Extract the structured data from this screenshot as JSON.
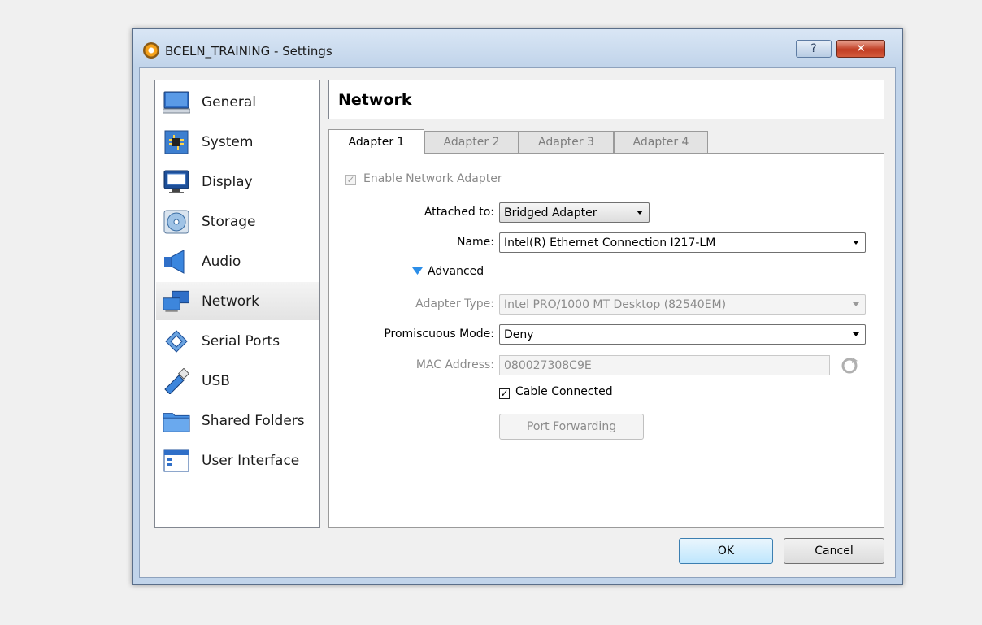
{
  "window": {
    "title": "BCELN_TRAINING - Settings",
    "help_glyph": "?",
    "close_glyph": "✕"
  },
  "sidebar": {
    "items": [
      {
        "label": "General",
        "icon": "monitor-icon"
      },
      {
        "label": "System",
        "icon": "chip-icon"
      },
      {
        "label": "Display",
        "icon": "display-icon"
      },
      {
        "label": "Storage",
        "icon": "disk-icon"
      },
      {
        "label": "Audio",
        "icon": "speaker-icon"
      },
      {
        "label": "Network",
        "icon": "network-icon",
        "selected": true
      },
      {
        "label": "Serial Ports",
        "icon": "serial-port-icon"
      },
      {
        "label": "USB",
        "icon": "usb-icon"
      },
      {
        "label": "Shared Folders",
        "icon": "folder-icon"
      },
      {
        "label": "User Interface",
        "icon": "window-icon"
      }
    ]
  },
  "page": {
    "title": "Network"
  },
  "tabs": [
    {
      "label": "Adapter 1",
      "active": true
    },
    {
      "label": "Adapter 2"
    },
    {
      "label": "Adapter 3"
    },
    {
      "label": "Adapter 4"
    }
  ],
  "form": {
    "enable_adapter": {
      "label": "Enable Network Adapter",
      "checked": true,
      "disabled": true,
      "mark": "✓"
    },
    "attached_to": {
      "label": "Attached to:",
      "value": "Bridged Adapter"
    },
    "name": {
      "label": "Name:",
      "value": "Intel(R) Ethernet Connection I217-LM"
    },
    "advanced": {
      "label": "Advanced",
      "expanded": true
    },
    "adapter_type": {
      "label": "Adapter Type:",
      "value": "Intel PRO/1000 MT Desktop (82540EM)",
      "disabled": true
    },
    "promiscuous": {
      "label": "Promiscuous Mode:",
      "value": "Deny"
    },
    "mac": {
      "label": "MAC Address:",
      "value": "080027308C9E",
      "disabled": true
    },
    "cable": {
      "label": "Cable Connected",
      "checked": true,
      "mark": "✓"
    },
    "port_forwarding": {
      "label": "Port Forwarding",
      "disabled": true
    }
  },
  "footer": {
    "ok_label": "OK",
    "cancel_label": "Cancel"
  },
  "colors": {
    "window_frame": "#c1d4ea",
    "close_button": "#c13d23",
    "selection": "#e3e3e3",
    "accent_triangle": "#2c8ee8"
  }
}
